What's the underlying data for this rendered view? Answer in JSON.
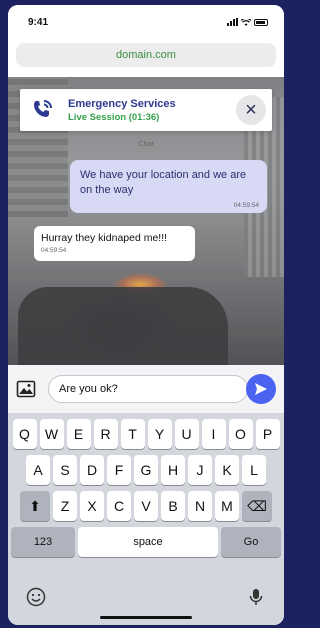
{
  "status_bar": {
    "time": "9:41",
    "icons": [
      "signal-icon",
      "wifi-icon",
      "battery-icon"
    ]
  },
  "browser": {
    "url": "domain.com"
  },
  "call": {
    "service": "Emergency Services",
    "session": "Live Session (01:36)",
    "icon": "phone-ringing-icon"
  },
  "chat": {
    "label": "Chat",
    "messages": [
      {
        "direction": "incoming-right",
        "text": "We have your location and we are on the way",
        "time": "04:59:54"
      },
      {
        "direction": "outgoing-left",
        "text": "Hurray they kidnaped me!!!",
        "time": "04:59:54"
      }
    ]
  },
  "composer": {
    "value": "Are you ok?",
    "send_icon": "send-icon",
    "attach_icon": "image-icon"
  },
  "keyboard": {
    "row1": [
      "Q",
      "W",
      "E",
      "R",
      "T",
      "Y",
      "U",
      "I",
      "O",
      "P"
    ],
    "row2": [
      "A",
      "S",
      "D",
      "F",
      "G",
      "H",
      "J",
      "K",
      "L"
    ],
    "row3": [
      "Z",
      "X",
      "C",
      "V",
      "B",
      "N",
      "M"
    ],
    "shift": "⬆",
    "backspace": "⌫",
    "numbers": "123",
    "space": "space",
    "go": "Go",
    "emoji_icon": "emoji-icon",
    "mic_icon": "microphone-icon"
  },
  "colors": {
    "accent": "#4a63f0",
    "live": "#33a24a",
    "brand_text": "#2e3a8f",
    "background": "#1c2160"
  }
}
